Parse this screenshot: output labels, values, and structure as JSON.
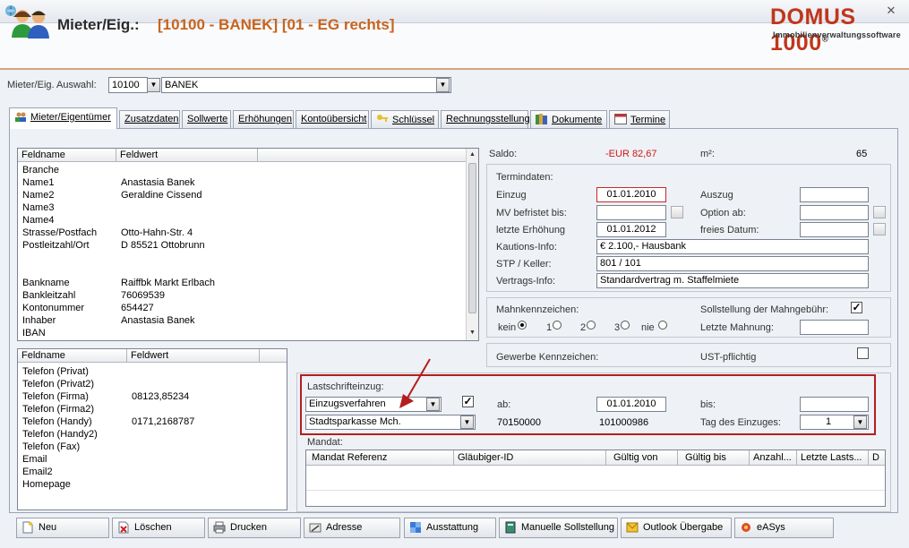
{
  "header": {
    "label": "Mieter/Eig.:",
    "value": "[10100 - BANEK] [01 - EG rechts]",
    "logo_main": "DOMUS 1000",
    "logo_reg": "®",
    "logo_sub": "Immobilienverwaltungssoftware"
  },
  "selection": {
    "label": "Mieter/Eig. Auswahl:",
    "number": "10100",
    "name": "BANEK"
  },
  "tabs": [
    {
      "label": "Mieter/Eigentümer"
    },
    {
      "label": "Zusatzdaten"
    },
    {
      "label": "Sollwerte"
    },
    {
      "label": "Erhöhungen"
    },
    {
      "label": "Kontoübersicht"
    },
    {
      "label": "Schlüssel"
    },
    {
      "label": "Rechnungsstellung"
    },
    {
      "label": "Dokumente"
    },
    {
      "label": "Termine"
    }
  ],
  "grid1": {
    "headers": [
      "Feldname",
      "Feldwert"
    ],
    "rows": [
      [
        "Branche",
        ""
      ],
      [
        "Name1",
        "Anastasia Banek"
      ],
      [
        "Name2",
        "Geraldine Cissend"
      ],
      [
        "Name3",
        ""
      ],
      [
        "Name4",
        ""
      ],
      [
        "Strasse/Postfach",
        "Otto-Hahn-Str. 4"
      ],
      [
        "Postleitzahl/Ort",
        "D 85521 Ottobrunn"
      ],
      [
        "",
        ""
      ],
      [
        "",
        ""
      ],
      [
        "Bankname",
        "Raiffbk Markt Erlbach"
      ],
      [
        "Bankleitzahl",
        "76069539"
      ],
      [
        "Kontonummer",
        "654427"
      ],
      [
        "Inhaber",
        "Anastasia Banek"
      ],
      [
        "IBAN",
        ""
      ]
    ]
  },
  "grid2": {
    "headers": [
      "Feldname",
      "Feldwert"
    ],
    "rows": [
      [
        "Telefon (Privat)",
        ""
      ],
      [
        "Telefon (Privat2)",
        ""
      ],
      [
        "Telefon (Firma)",
        "08123,85234"
      ],
      [
        "Telefon (Firma2)",
        ""
      ],
      [
        "Telefon (Handy)",
        "0171,2168787"
      ],
      [
        "Telefon (Handy2)",
        ""
      ],
      [
        "Telefon (Fax)",
        ""
      ],
      [
        "Email",
        ""
      ],
      [
        "Email2",
        ""
      ],
      [
        "Homepage",
        ""
      ]
    ]
  },
  "saldo": {
    "label": "Saldo:",
    "value": "-EUR 82,67",
    "m2_label": "m²:",
    "m2_value": "65"
  },
  "termin": {
    "title": "Termindaten:",
    "einzug_label": "Einzug",
    "einzug": "01.01.2010",
    "auszug_label": "Auszug",
    "mv_label": "MV befristet bis:",
    "option_label": "Option ab:",
    "erh_label": "letzte Erhöhung",
    "erh": "01.01.2012",
    "frei_label": "freies Datum:",
    "kaution_label": "Kautions-Info:",
    "kaution": "€ 2.100,- Hausbank",
    "stp_label": "STP / Keller:",
    "stp": "801 / 101",
    "vertrag_label": "Vertrags-Info:",
    "vertrag": "Standardvertrag m. Staffelmiete"
  },
  "mahn": {
    "title": "Mahnkennzeichen:",
    "opt_kein": "kein",
    "opt_1": "1",
    "opt_2": "2",
    "opt_3": "3",
    "opt_nie": "nie",
    "soll_label": "Sollstellung der Mahngebühr:",
    "letzte_label": "Letzte Mahnung:"
  },
  "gewerbe": {
    "label": "Gewerbe Kennzeichen:",
    "ust_label": "UST-pflichtig"
  },
  "lastschrift": {
    "title": "Lastschrifteinzug:",
    "verfahren": "Einzugsverfahren",
    "ab_label": "ab:",
    "ab": "01.01.2010",
    "bis_label": "bis:",
    "bank": "Stadtsparkasse Mch.",
    "blz": "70150000",
    "konto": "101000986",
    "tag_label": "Tag des Einzuges:",
    "tag": "1",
    "highlight_color": "#b41e1e"
  },
  "mandat": {
    "title": "Mandat:",
    "headers": [
      "Mandat Referenz",
      "Gläubiger-ID",
      "Gültig von",
      "Gültig bis",
      "Anzahl...",
      "Letzte Lasts...",
      "D"
    ]
  },
  "buttons": [
    {
      "label": "Neu",
      "icon": "new-document-icon"
    },
    {
      "label": "Löschen",
      "icon": "delete-icon"
    },
    {
      "label": "Drucken",
      "icon": "printer-icon"
    },
    {
      "label": "Adresse",
      "icon": "address-icon"
    },
    {
      "label": "Ausstattung",
      "icon": "puzzle-icon"
    },
    {
      "label": "Manuelle Sollstellung",
      "icon": "calculator-icon"
    },
    {
      "label": "Outlook Übergabe",
      "icon": "outlook-icon"
    },
    {
      "label": "eASys",
      "icon": "easys-icon"
    }
  ],
  "colors": {
    "accent": "#c8641e",
    "logo": "#c0361b",
    "saldo_negative": "#d01818"
  }
}
